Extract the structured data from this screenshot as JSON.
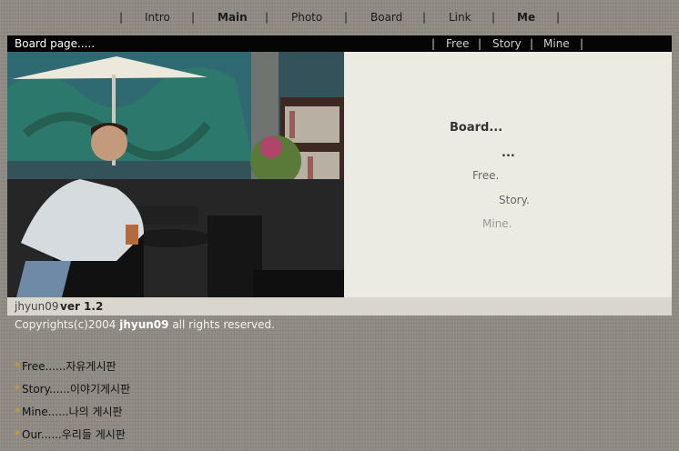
{
  "nav": {
    "items": [
      "Intro",
      "Main",
      "Photo",
      "Board",
      "Link",
      "Me"
    ],
    "separator": "|"
  },
  "header": {
    "title": "Board page.....",
    "subnav": [
      "Free",
      "Story",
      "Mine"
    ],
    "separator": "|"
  },
  "panel": {
    "title": "Board...",
    "dots": "...",
    "links": [
      "Free.",
      "Story.",
      "Mine."
    ]
  },
  "version_bar": {
    "user": "jhyun09",
    "version": "ver 1.2"
  },
  "copyright": {
    "prefix": "Copyrights(c)2004",
    "name": "jhyun09",
    "suffix": "all rights reserved."
  },
  "board_list": {
    "bullet": "*",
    "items": [
      "Free......자유게시판",
      "Story......이야기게시판",
      "Mine......나의 게시판",
      "Our......우리들 게시판"
    ]
  }
}
